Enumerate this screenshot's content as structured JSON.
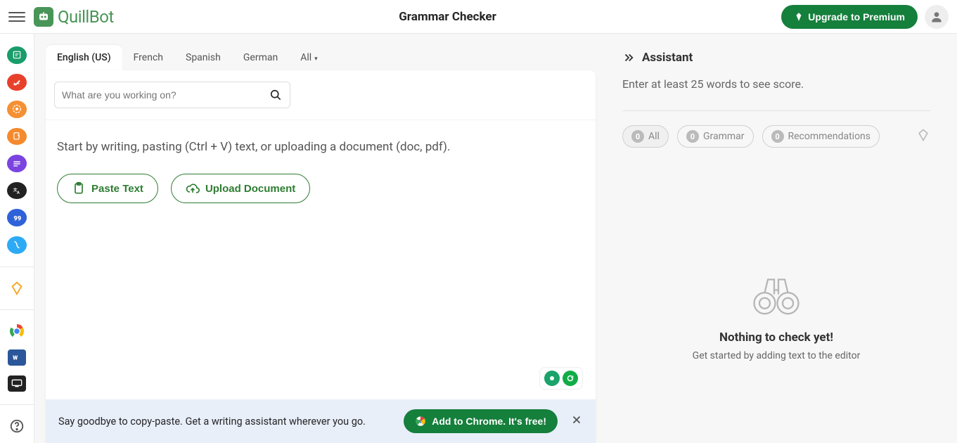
{
  "header": {
    "logo_text": "QuillBot",
    "title": "Grammar Checker",
    "upgrade_label": "Upgrade to Premium"
  },
  "tabs": [
    {
      "label": "English (US)",
      "active": true
    },
    {
      "label": "French"
    },
    {
      "label": "Spanish"
    },
    {
      "label": "German"
    },
    {
      "label": "All"
    }
  ],
  "search": {
    "placeholder": "What are you working on?"
  },
  "editor": {
    "placeholder": "Start by writing, pasting (Ctrl + V) text, or uploading a document (doc, pdf).",
    "paste_label": "Paste Text",
    "upload_label": "Upload Document"
  },
  "banner": {
    "text": "Say goodbye to copy-paste. Get a writing assistant wherever you go.",
    "button": "Add to Chrome. It's free!"
  },
  "assistant": {
    "title": "Assistant",
    "hint": "Enter at least 25 words to see score.",
    "chips": {
      "all": {
        "count": "0",
        "label": "All"
      },
      "grammar": {
        "count": "0",
        "label": "Grammar"
      },
      "recs": {
        "count": "0",
        "label": "Recommendations"
      }
    },
    "empty": {
      "title": "Nothing to check yet!",
      "sub": "Get started by adding text to the editor"
    }
  },
  "sidebar_colors": {
    "paraphraser": "#1a9c6b",
    "grammar": "#e8412b",
    "plagiarism": "#f59033",
    "cowriter": "#f58a2d",
    "summarizer": "#7b44e0",
    "translator": "#222",
    "citation": "#2f62d9",
    "flow": "#2daaf5",
    "premium": "#f5a623"
  }
}
